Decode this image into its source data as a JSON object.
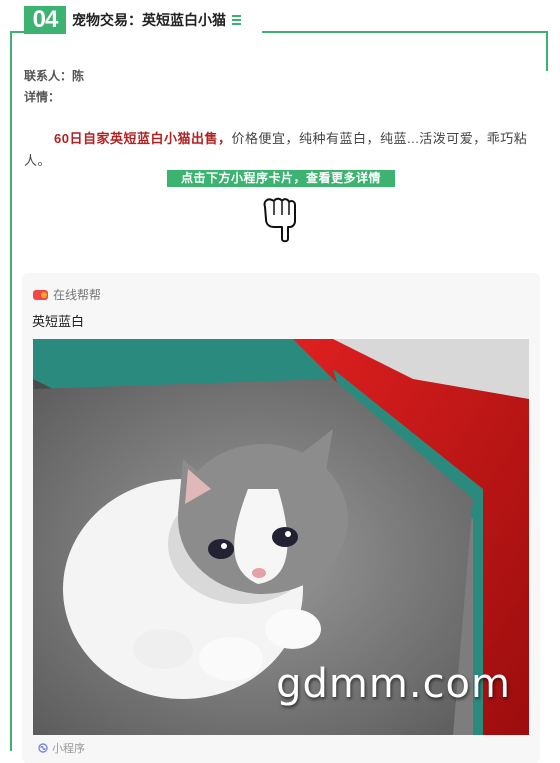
{
  "header": {
    "number": "04",
    "title": "宠物交易：英短蓝白小猫"
  },
  "contact": "联系人：陈",
  "details_label": "详情：",
  "description": {
    "highlight": "60日自家英短蓝白小猫出售，",
    "rest": "价格便宜，纯种有蓝白，纯蓝...活泼可爱，乖巧粘人。"
  },
  "cta": "点击下方小程序卡片，查看更多详情",
  "card": {
    "source": "在线帮帮",
    "title": "英短蓝白",
    "image_icon": "kitten-photo",
    "watermark": "gdmm.com",
    "footer": "小程序"
  },
  "colors": {
    "accent": "#3cb371",
    "highlight": "#b22222"
  }
}
